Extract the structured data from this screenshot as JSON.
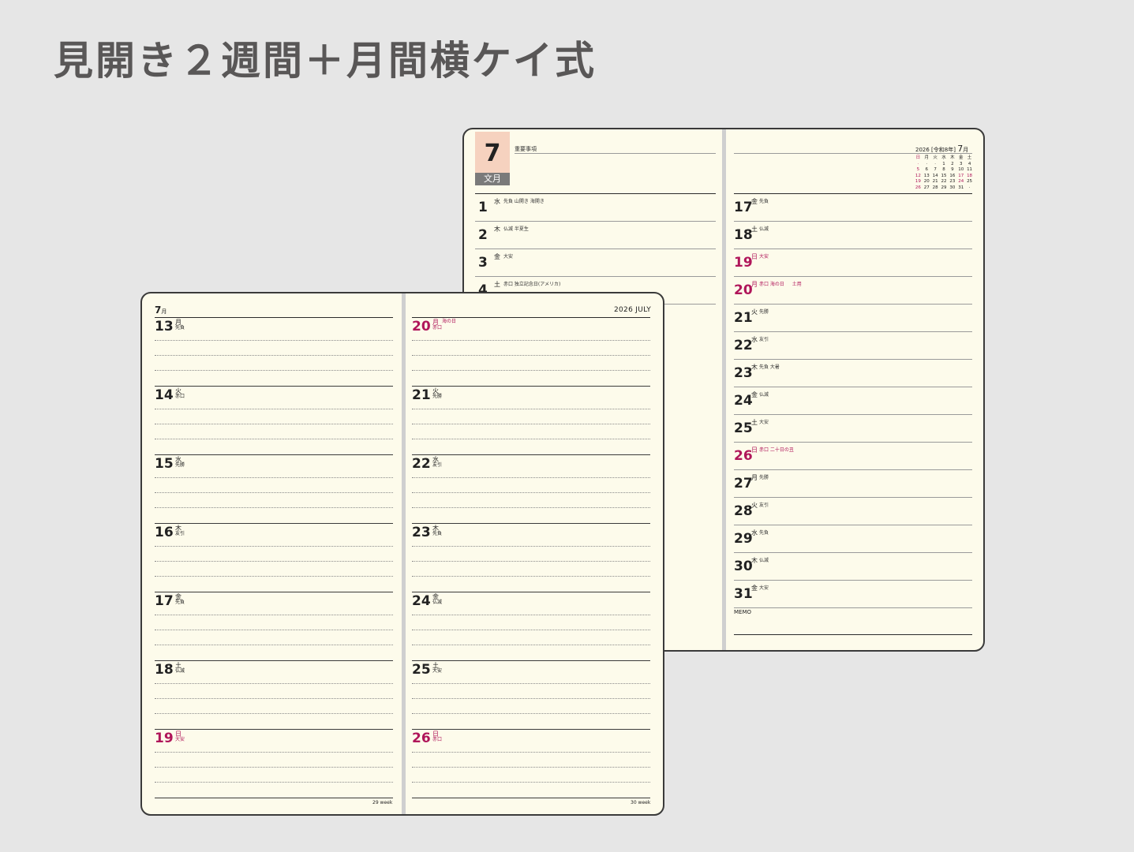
{
  "title": "見開き２週間＋月間横ケイ式",
  "colors": {
    "holiday": "#b0165a",
    "badge": "#f6d2bf",
    "paper": "#fdfbeb"
  },
  "monthly": {
    "month_number": "7",
    "month_japanese": "文月",
    "notes_label": "重要事項",
    "mini_calendar": {
      "header": "2026 [令和8年]",
      "month": "7",
      "month_suffix": "月",
      "weekdays": [
        "日",
        "月",
        "火",
        "水",
        "木",
        "金",
        "土"
      ],
      "days": [
        "·",
        "·",
        "·",
        "1",
        "2",
        "3",
        "4",
        "5",
        "6",
        "7",
        "8",
        "9",
        "10",
        "11",
        "12",
        "13",
        "14",
        "15",
        "16",
        "17",
        "18",
        "19",
        "20",
        "21",
        "22",
        "23",
        "24",
        "25",
        "26",
        "27",
        "28",
        "29",
        "30",
        "31",
        "·"
      ]
    },
    "left_days": [
      {
        "day": "1",
        "weekday": "水",
        "note": "先負 山開き 海開き"
      },
      {
        "day": "2",
        "weekday": "木",
        "note": "仏滅 半夏生"
      },
      {
        "day": "3",
        "weekday": "金",
        "note": "大安"
      },
      {
        "day": "4",
        "weekday": "土",
        "note": "赤口 独立記念日(アメリカ)"
      }
    ],
    "right_days": [
      {
        "day": "17",
        "weekday": "金",
        "note": "先負",
        "holiday": false
      },
      {
        "day": "18",
        "weekday": "土",
        "note": "仏滅",
        "holiday": false
      },
      {
        "day": "19",
        "weekday": "日",
        "note": "大安",
        "holiday": true
      },
      {
        "day": "20",
        "weekday": "月",
        "note": "赤口 海の日 　 土用",
        "holiday": true
      },
      {
        "day": "21",
        "weekday": "火",
        "note": "先勝",
        "holiday": false
      },
      {
        "day": "22",
        "weekday": "水",
        "note": "友引",
        "holiday": false
      },
      {
        "day": "23",
        "weekday": "木",
        "note": "先負 大暑",
        "holiday": false
      },
      {
        "day": "24",
        "weekday": "金",
        "note": "仏滅",
        "holiday": false
      },
      {
        "day": "25",
        "weekday": "土",
        "note": "大安",
        "holiday": false
      },
      {
        "day": "26",
        "weekday": "日",
        "note": "赤口 二十日の丑",
        "holiday": true
      },
      {
        "day": "27",
        "weekday": "月",
        "note": "先勝",
        "holiday": false
      },
      {
        "day": "28",
        "weekday": "火",
        "note": "友引",
        "holiday": false
      },
      {
        "day": "29",
        "weekday": "水",
        "note": "先負",
        "holiday": false
      },
      {
        "day": "30",
        "weekday": "木",
        "note": "仏滅",
        "holiday": false
      },
      {
        "day": "31",
        "weekday": "金",
        "note": "大安",
        "holiday": false
      }
    ],
    "memo_label": "MEMO"
  },
  "weekly": {
    "month": "7",
    "month_suffix": "月",
    "year_label": "2026 JULY",
    "left_days": [
      {
        "day": "13",
        "weekday": "月",
        "rokuyo": "先負",
        "event": "",
        "holiday": false
      },
      {
        "day": "14",
        "weekday": "火",
        "rokuyo": "赤口",
        "event": "",
        "holiday": false
      },
      {
        "day": "15",
        "weekday": "水",
        "rokuyo": "先勝",
        "event": "",
        "holiday": false
      },
      {
        "day": "16",
        "weekday": "木",
        "rokuyo": "友引",
        "event": "",
        "holiday": false
      },
      {
        "day": "17",
        "weekday": "金",
        "rokuyo": "先負",
        "event": "",
        "holiday": false
      },
      {
        "day": "18",
        "weekday": "土",
        "rokuyo": "仏滅",
        "event": "",
        "holiday": false
      },
      {
        "day": "19",
        "weekday": "日",
        "rokuyo": "大安",
        "event": "",
        "holiday": true
      }
    ],
    "right_days": [
      {
        "day": "20",
        "weekday": "月",
        "rokuyo": "赤口",
        "event": "海の日",
        "holiday": true
      },
      {
        "day": "21",
        "weekday": "火",
        "rokuyo": "先勝",
        "event": "",
        "holiday": false
      },
      {
        "day": "22",
        "weekday": "水",
        "rokuyo": "友引",
        "event": "",
        "holiday": false
      },
      {
        "day": "23",
        "weekday": "木",
        "rokuyo": "先負",
        "event": "",
        "holiday": false
      },
      {
        "day": "24",
        "weekday": "金",
        "rokuyo": "仏滅",
        "event": "",
        "holiday": false
      },
      {
        "day": "25",
        "weekday": "土",
        "rokuyo": "大安",
        "event": "",
        "holiday": false
      },
      {
        "day": "26",
        "weekday": "日",
        "rokuyo": "赤口",
        "event": "",
        "holiday": true
      }
    ],
    "left_week": "29 week",
    "right_week": "30 week"
  }
}
